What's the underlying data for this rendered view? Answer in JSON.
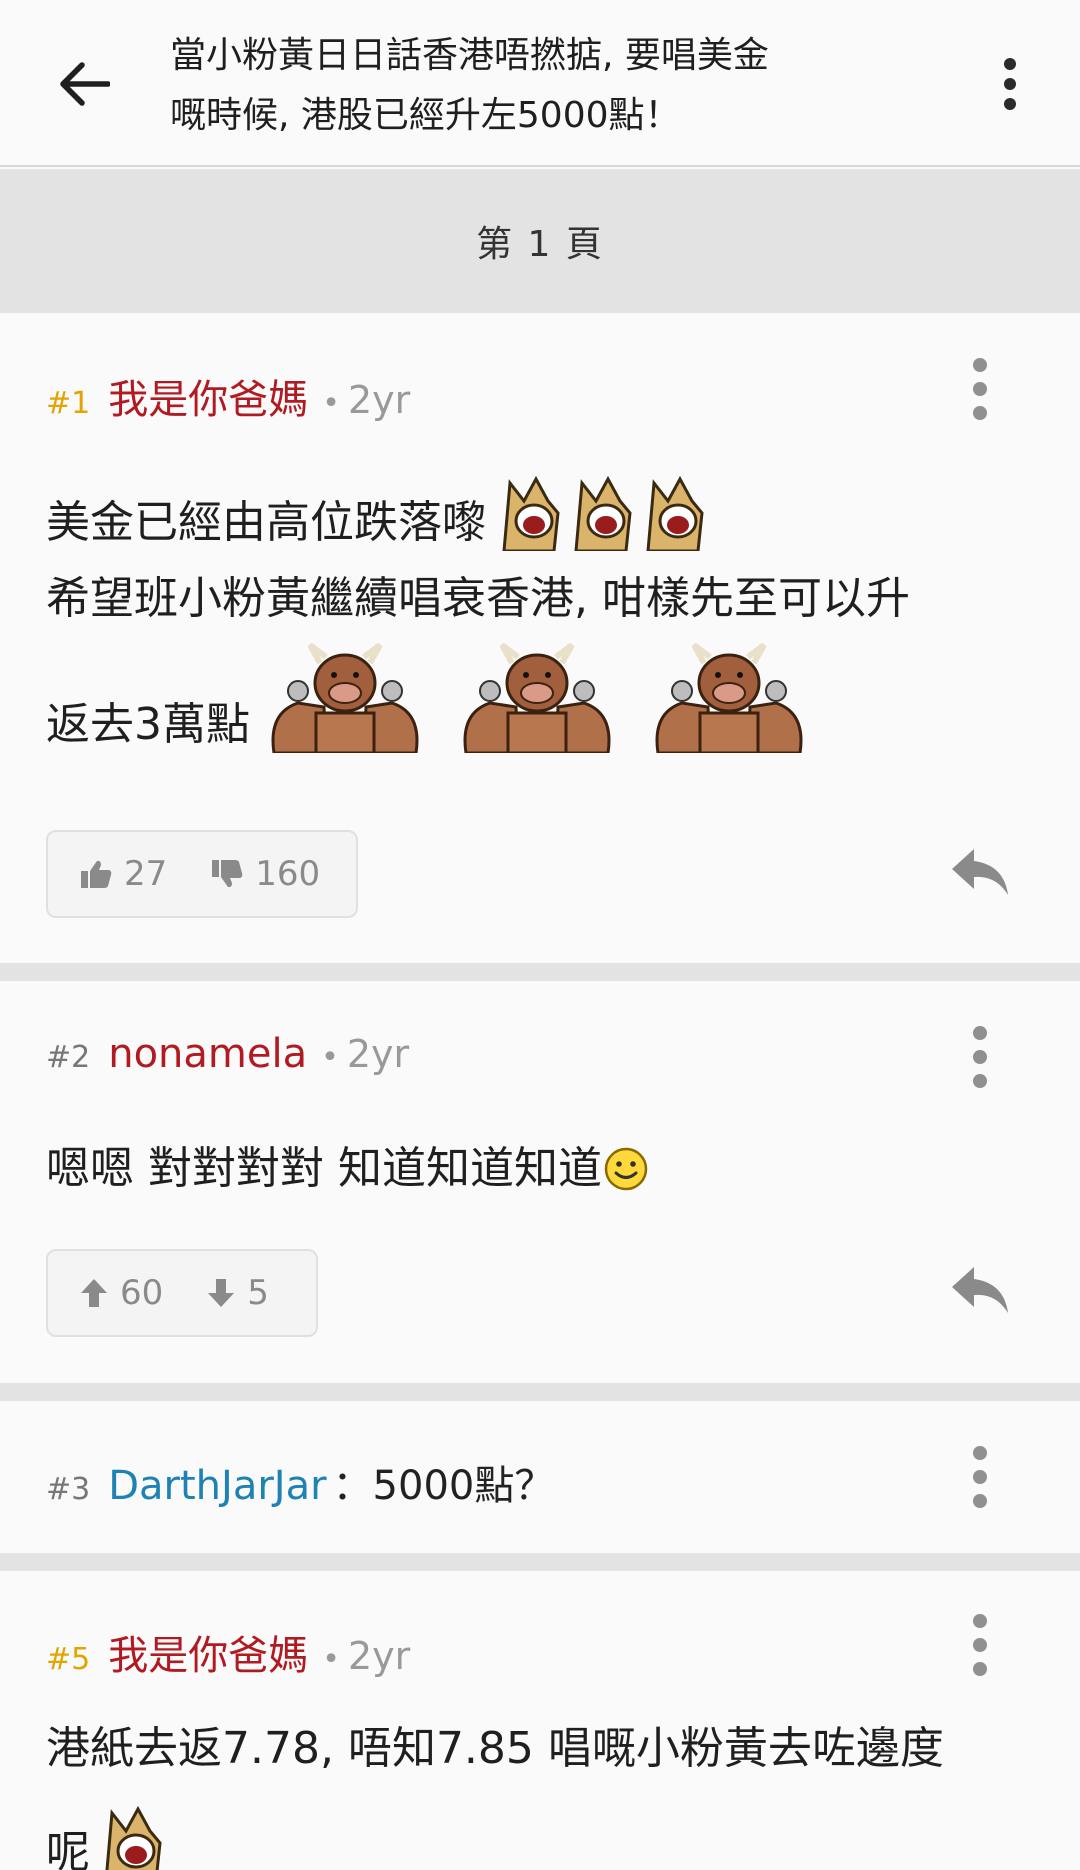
{
  "header": {
    "title": "當小粉黃日日話香港唔撚掂, 要唱美金嘅時候, 港股已經升左5000點！",
    "title_line1": "當小粉黃日日話香港唔撚掂, 要唱美金",
    "title_line2": "嘅時候, 港股已經升左5000點！",
    "back_icon": "arrow-left-icon",
    "menu_icon": "more-vertical-icon"
  },
  "page_indicator": "第 1 頁",
  "posts": [
    {
      "floor": "#1",
      "user": "我是你爸媽",
      "separator": "•",
      "time": "2yr",
      "line1": "美金已經由高位跌落嚟",
      "line2": "希望班小粉黃繼續唱衰香港, 咁樣先至可以升",
      "line3": "返去3萬點",
      "stickers_line1": [
        "dog-laugh-sticker",
        "dog-laugh-sticker",
        "dog-laugh-sticker"
      ],
      "stickers_line3": [
        "bull-flex-sticker",
        "bull-flex-sticker",
        "bull-flex-sticker"
      ],
      "likes": "27",
      "dislikes": "160",
      "like_icon": "thumbs-up-icon",
      "dislike_icon": "thumbs-down-icon"
    },
    {
      "floor": "#2",
      "user": "nonamela",
      "separator": "•",
      "time": "2yr",
      "text": "嗯嗯 對對對對 知道知道知道",
      "emoji": "smiley-face-icon",
      "upvotes": "60",
      "downvotes": "5",
      "up_icon": "arrow-up-icon",
      "down_icon": "arrow-down-icon"
    },
    {
      "floor": "#3",
      "user": "DarthJarJar",
      "colon": "：",
      "quote": "5000點？"
    },
    {
      "floor": "#5",
      "user": "我是你爸媽",
      "separator": "•",
      "time": "2yr",
      "line1": "港紙去返7.78, 唔知7.85 唱嘅小粉黃去咗邊度",
      "line2": "呢"
    }
  ],
  "colors": {
    "floor_gold": "#e2a400",
    "user_red": "#b21a22",
    "user_blue": "#1e82b4",
    "separator_bg": "#e3e3e3"
  }
}
